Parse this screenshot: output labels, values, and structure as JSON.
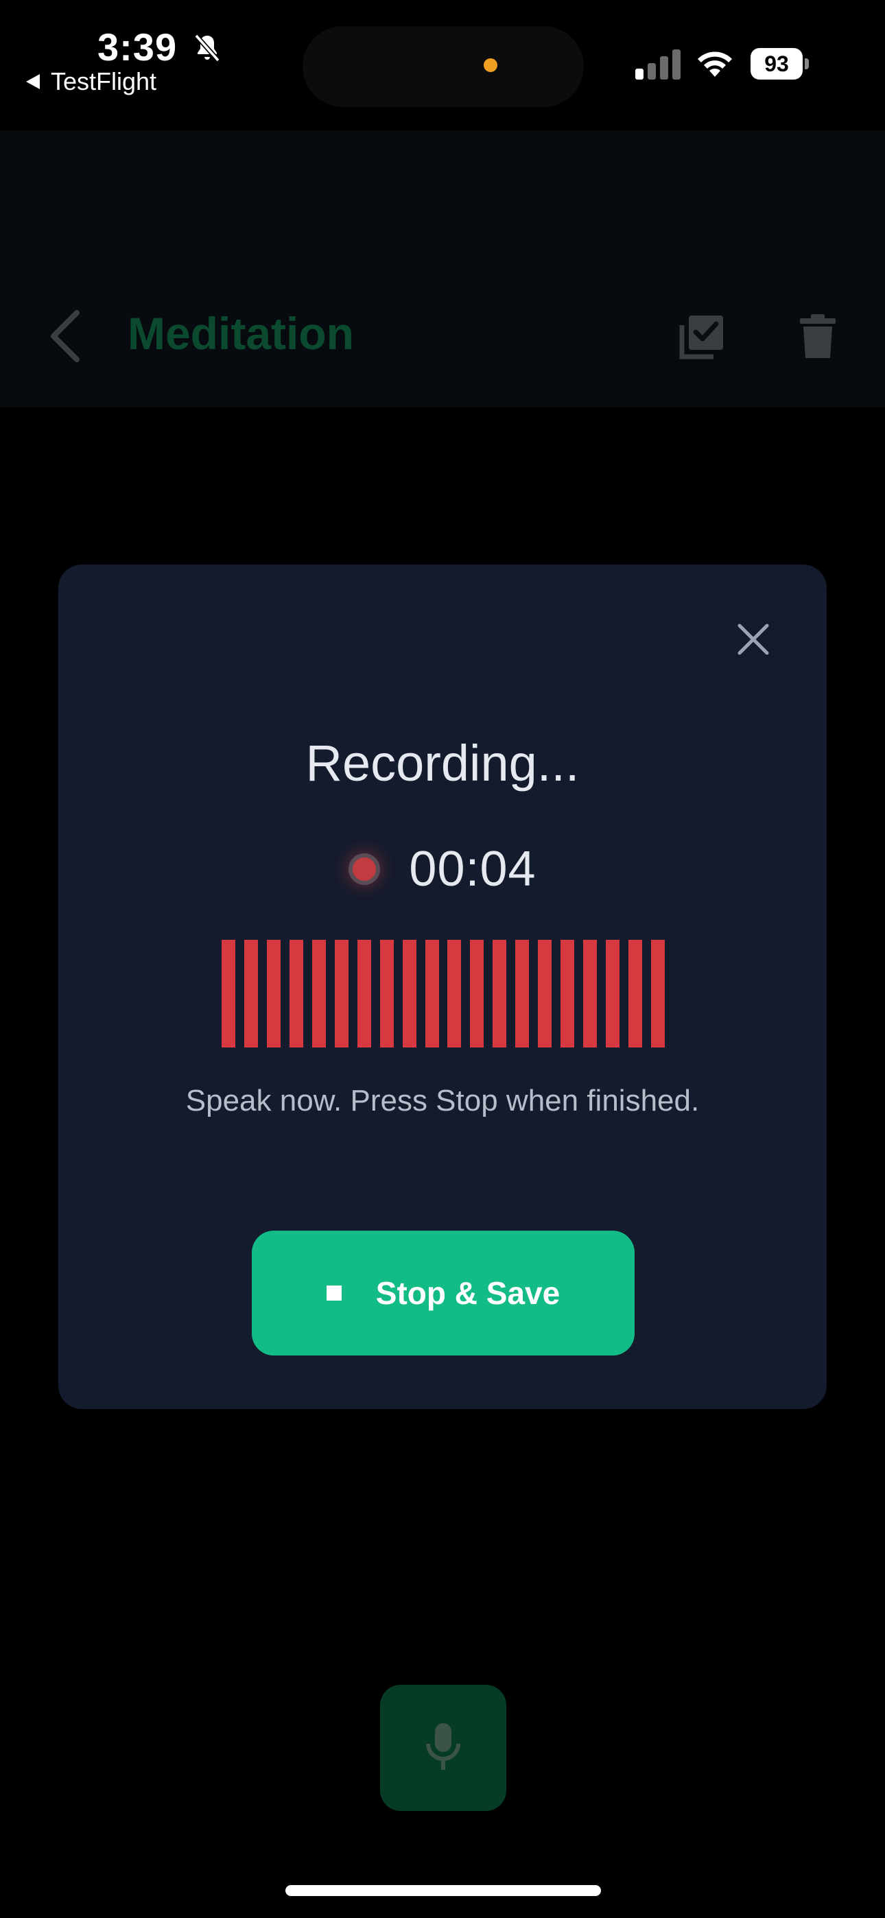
{
  "status_bar": {
    "time": "3:39",
    "back_app": "TestFlight",
    "battery": "93"
  },
  "page": {
    "title": "Meditation",
    "icons": [
      "chevron-left-icon",
      "checklist-icon",
      "trash-icon",
      "microphone-icon"
    ]
  },
  "modal": {
    "title": "Recording...",
    "timer": "00:04",
    "instruction": "Speak now. Press Stop when finished.",
    "stop_button_label": "Stop & Save",
    "waveform_bar_count": 20
  },
  "colors": {
    "background": "#000000",
    "modal_bg": "#131b2c",
    "accent_green": "#13bc86",
    "recording_red": "#d6393f",
    "dim_title": "#0c4a2f"
  }
}
